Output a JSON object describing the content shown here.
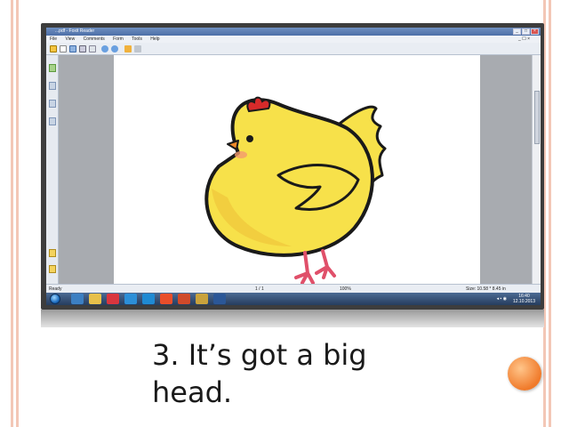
{
  "slide": {
    "caption": "3. It’s got a big head."
  },
  "window": {
    "title": "...pdf - Foxit Reader",
    "menu": [
      "File",
      "View",
      "Comments",
      "Form",
      "Tools",
      "Help"
    ],
    "doc_close": "_ ☐ ×"
  },
  "statusbar": {
    "left": "Ready",
    "page": "1 / 1",
    "zoom": "100%",
    "size": "Size: 10.58 * 8.45 in"
  },
  "taskbar": {
    "time": "16:40",
    "date": "12.10.2013"
  },
  "colors": {
    "accent_orange": "#f07a2a",
    "chick_yellow": "#f7e14a",
    "comb_red": "#d62a2a"
  },
  "icons": {
    "start": "windows-start-icon",
    "browser": "ie-icon",
    "folder": "folder-icon",
    "chick": "chick-illustration"
  }
}
